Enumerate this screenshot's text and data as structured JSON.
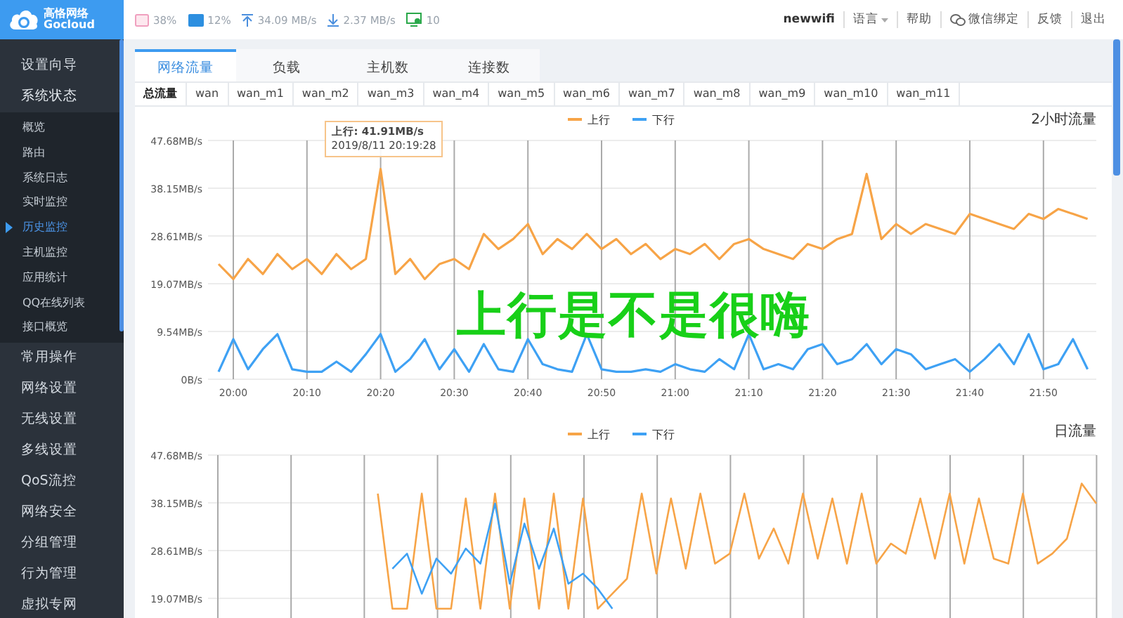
{
  "logo": {
    "name": "高恪网络",
    "sub": "Gocloud"
  },
  "status": {
    "cpu": "38%",
    "ram": "12%",
    "upload": "34.09 MB/s",
    "download": "2.37 MB/s",
    "hosts": "10"
  },
  "top_links": [
    {
      "kind": "user",
      "label": "newwifi"
    },
    {
      "kind": "dropdown",
      "label": "语言"
    },
    {
      "kind": "link",
      "label": "帮助"
    },
    {
      "kind": "wechat",
      "label": "微信绑定"
    },
    {
      "kind": "link",
      "label": "反馈"
    },
    {
      "kind": "link",
      "label": "退出"
    }
  ],
  "sidebar": {
    "items": [
      {
        "label": "设置向导",
        "expanded": false
      },
      {
        "label": "系统状态",
        "expanded": true,
        "children": [
          {
            "label": "概览",
            "selected": false
          },
          {
            "label": "路由",
            "selected": false
          },
          {
            "label": "系统日志",
            "selected": false
          },
          {
            "label": "实时监控",
            "selected": false
          },
          {
            "label": "历史监控",
            "selected": true
          },
          {
            "label": "主机监控",
            "selected": false
          },
          {
            "label": "应用统计",
            "selected": false
          },
          {
            "label": "QQ在线列表",
            "selected": false
          },
          {
            "label": "接口概览",
            "selected": false
          }
        ]
      },
      {
        "label": "常用操作",
        "expanded": false
      },
      {
        "label": "网络设置",
        "expanded": false
      },
      {
        "label": "无线设置",
        "expanded": false
      },
      {
        "label": "多线设置",
        "expanded": false
      },
      {
        "label": "QoS流控",
        "expanded": false
      },
      {
        "label": "网络安全",
        "expanded": false
      },
      {
        "label": "分组管理",
        "expanded": false
      },
      {
        "label": "行为管理",
        "expanded": false
      },
      {
        "label": "虚拟专网",
        "expanded": false
      }
    ]
  },
  "tabs": [
    {
      "label": "网络流量",
      "selected": true
    },
    {
      "label": "负载",
      "selected": false
    },
    {
      "label": "主机数",
      "selected": false
    },
    {
      "label": "连接数",
      "selected": false
    }
  ],
  "subtabs": [
    {
      "label": "总流量",
      "selected": true
    },
    {
      "label": "wan",
      "selected": false
    },
    {
      "label": "wan_m1",
      "selected": false
    },
    {
      "label": "wan_m2",
      "selected": false
    },
    {
      "label": "wan_m3",
      "selected": false
    },
    {
      "label": "wan_m4",
      "selected": false
    },
    {
      "label": "wan_m5",
      "selected": false
    },
    {
      "label": "wan_m6",
      "selected": false
    },
    {
      "label": "wan_m7",
      "selected": false
    },
    {
      "label": "wan_m8",
      "selected": false
    },
    {
      "label": "wan_m9",
      "selected": false
    },
    {
      "label": "wan_m10",
      "selected": false
    },
    {
      "label": "wan_m11",
      "selected": false
    }
  ],
  "hourly": {
    "tooltip": {
      "title": "上行: 41.91MB/s",
      "time": "2019/8/11 20:19:28"
    },
    "overlay_caption": "上行是不是很嗨",
    "chart_data": {
      "type": "line",
      "title": "2小时流量",
      "grid": true,
      "legend": true,
      "categories": [
        null,
        "20:00",
        null,
        null,
        null,
        null,
        "20:10",
        null,
        null,
        null,
        null,
        "20:20",
        null,
        null,
        null,
        null,
        "20:30",
        null,
        null,
        null,
        null,
        "20:40",
        null,
        null,
        null,
        null,
        "20:50",
        null,
        null,
        null,
        null,
        "21:00",
        null,
        null,
        null,
        null,
        "21:10",
        null,
        null,
        null,
        null,
        "21:20",
        null,
        null,
        null,
        null,
        "21:30",
        null,
        null,
        null,
        null,
        "21:40",
        null,
        null,
        null,
        null,
        "21:50",
        null,
        null,
        null
      ],
      "series": [
        {
          "name": "上行",
          "color": "#f7a447",
          "values": [
            23,
            20,
            24,
            21,
            25,
            22,
            24,
            21,
            25,
            22,
            24,
            42,
            21,
            24,
            20,
            23,
            24,
            22,
            29,
            26,
            28,
            31,
            25,
            28,
            26,
            29,
            26,
            28,
            25,
            27,
            24,
            26,
            25,
            27,
            24,
            27,
            28,
            26,
            25,
            24,
            27,
            26,
            28,
            29,
            41,
            28,
            31,
            29,
            31,
            30,
            29,
            33,
            32,
            31,
            30,
            33,
            32,
            34,
            33,
            32
          ]
        },
        {
          "name": "下行",
          "color": "#3ea1f4",
          "values": [
            1.5,
            8,
            2,
            6,
            9,
            2,
            1.5,
            1.5,
            3.5,
            1.5,
            5,
            9,
            1.5,
            4,
            8,
            2,
            6,
            1.5,
            7,
            2,
            1.5,
            8,
            3,
            2,
            1.5,
            9,
            2,
            1.5,
            1.5,
            2,
            1.5,
            3,
            2,
            1.5,
            4,
            2,
            9,
            2,
            3,
            2,
            6,
            7,
            3,
            4,
            7,
            3,
            6,
            5,
            2,
            3,
            4,
            1.5,
            4,
            7,
            3,
            9,
            2,
            3,
            8,
            2
          ]
        }
      ],
      "ylim": [
        0,
        47.68
      ],
      "yticks": [
        {
          "value": 0,
          "label": "0B/s"
        },
        {
          "value": 9.54,
          "label": "9.54MB/s"
        },
        {
          "value": 19.07,
          "label": "19.07MB/s"
        },
        {
          "value": 28.61,
          "label": "28.61MB/s"
        },
        {
          "value": 38.15,
          "label": "38.15MB/s"
        },
        {
          "value": 47.68,
          "label": "47.68MB/s"
        }
      ]
    }
  },
  "daily": {
    "chart_data": {
      "type": "line",
      "title": "日流量",
      "grid": true,
      "legend": true,
      "series": [
        {
          "name": "上行",
          "color": "#f7a447",
          "values": [
            null,
            null,
            null,
            null,
            null,
            null,
            null,
            null,
            null,
            null,
            null,
            40,
            17,
            17,
            40,
            17,
            17,
            39,
            17,
            40,
            17,
            39,
            17,
            40,
            17,
            39,
            17,
            20,
            23,
            40,
            24,
            39,
            25,
            40,
            26,
            28,
            40,
            27,
            33,
            26,
            40,
            27,
            39,
            26,
            40,
            26,
            30,
            28,
            39,
            27,
            40,
            26,
            39,
            27,
            26,
            40,
            26,
            28,
            31,
            42,
            38
          ]
        },
        {
          "name": "下行",
          "color": "#3ea1f4",
          "values": [
            null,
            null,
            null,
            null,
            null,
            null,
            null,
            null,
            null,
            null,
            null,
            null,
            25,
            28,
            20,
            27,
            24,
            29,
            26,
            38,
            22,
            34,
            25,
            33,
            22,
            24,
            21,
            17,
            null,
            null,
            null,
            null,
            null,
            null,
            null,
            null,
            null,
            null,
            null,
            null,
            null,
            null,
            null,
            null,
            null,
            null,
            null,
            null,
            null,
            null,
            null,
            null,
            null,
            null,
            null,
            null,
            null,
            null,
            null,
            null,
            null
          ]
        }
      ],
      "ylim": [
        0,
        47.68
      ],
      "yticks": [
        {
          "value": 19.07,
          "label": "19.07MB/s"
        },
        {
          "value": 28.61,
          "label": "28.61MB/s"
        },
        {
          "value": 38.15,
          "label": "38.15MB/s"
        },
        {
          "value": 47.68,
          "label": "47.68MB/s"
        }
      ]
    }
  }
}
